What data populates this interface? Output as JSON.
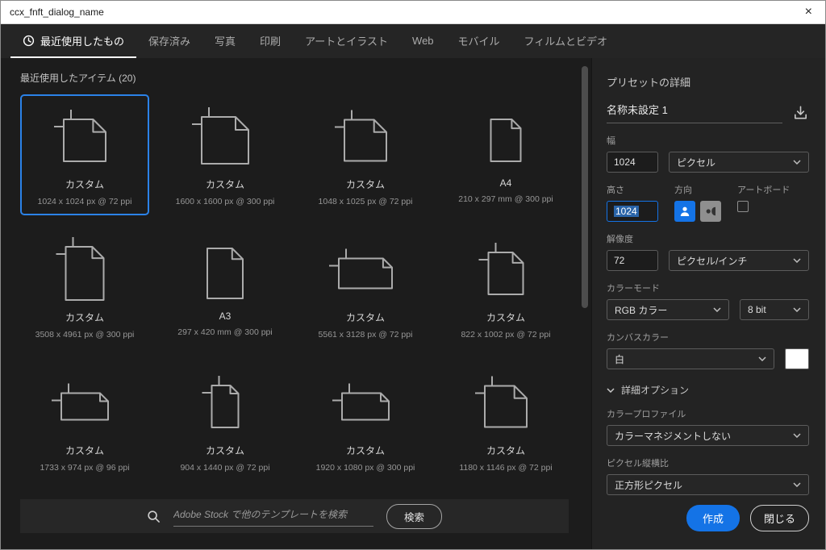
{
  "titlebar": {
    "title": "ccx_fnft_dialog_name",
    "close_glyph": "×"
  },
  "tabs": {
    "items": [
      {
        "label": "最近使用したもの",
        "active": true
      },
      {
        "label": "保存済み",
        "active": false
      },
      {
        "label": "写真",
        "active": false
      },
      {
        "label": "印刷",
        "active": false
      },
      {
        "label": "アートとイラスト",
        "active": false
      },
      {
        "label": "Web",
        "active": false
      },
      {
        "label": "モバイル",
        "active": false
      },
      {
        "label": "フィルムとビデオ",
        "active": false
      }
    ]
  },
  "recent": {
    "section_title": "最近使用したアイテム (20)",
    "items": [
      {
        "name": "カスタム",
        "dims": "1024 x 1024 px @ 72 ppi",
        "selected": true
      },
      {
        "name": "カスタム",
        "dims": "1600 x 1600 px @ 300 ppi",
        "selected": false
      },
      {
        "name": "カスタム",
        "dims": "1048 x 1025 px @ 72 ppi",
        "selected": false
      },
      {
        "name": "A4",
        "dims": "210 x 297 mm @ 300 ppi",
        "selected": false
      },
      {
        "name": "カスタム",
        "dims": "3508 x 4961 px @ 300 ppi",
        "selected": false
      },
      {
        "name": "A3",
        "dims": "297 x 420 mm @ 300 ppi",
        "selected": false
      },
      {
        "name": "カスタム",
        "dims": "5561 x 3128 px @ 72 ppi",
        "selected": false
      },
      {
        "name": "カスタム",
        "dims": "822 x 1002 px @ 72 ppi",
        "selected": false
      },
      {
        "name": "カスタム",
        "dims": "1733 x 974 px @ 96 ppi",
        "selected": false
      },
      {
        "name": "カスタム",
        "dims": "904 x 1440 px @ 72 ppi",
        "selected": false
      },
      {
        "name": "カスタム",
        "dims": "1920 x 1080 px @ 300 ppi",
        "selected": false
      },
      {
        "name": "カスタム",
        "dims": "1180 x 1146 px @ 72 ppi",
        "selected": false
      }
    ]
  },
  "search": {
    "placeholder": "Adobe Stock で他のテンプレートを検索",
    "button_label": "検索"
  },
  "panel": {
    "title": "プリセットの詳細",
    "document_name": "名称未設定 1",
    "width": {
      "label": "幅",
      "value": "1024",
      "unit": "ピクセル"
    },
    "height": {
      "label": "高さ",
      "value": "1024"
    },
    "orientation": {
      "label": "方向"
    },
    "artboard": {
      "label": "アートボード"
    },
    "resolution": {
      "label": "解像度",
      "value": "72",
      "unit": "ピクセル/インチ"
    },
    "color_mode": {
      "label": "カラーモード",
      "value": "RGB カラー",
      "bit_depth": "8 bit"
    },
    "canvas_color": {
      "label": "カンバスカラー",
      "value": "白",
      "swatch": "#ffffff"
    },
    "advanced": {
      "label": "詳細オプション"
    },
    "color_profile": {
      "label": "カラープロファイル",
      "value": "カラーマネジメントしない"
    },
    "pixel_aspect": {
      "label": "ピクセル縦横比",
      "value": "正方形ピクセル"
    },
    "create_label": "作成",
    "close_label": "閉じる"
  },
  "colors": {
    "accent": "#1473e6",
    "selection_border": "#2b82e8"
  }
}
